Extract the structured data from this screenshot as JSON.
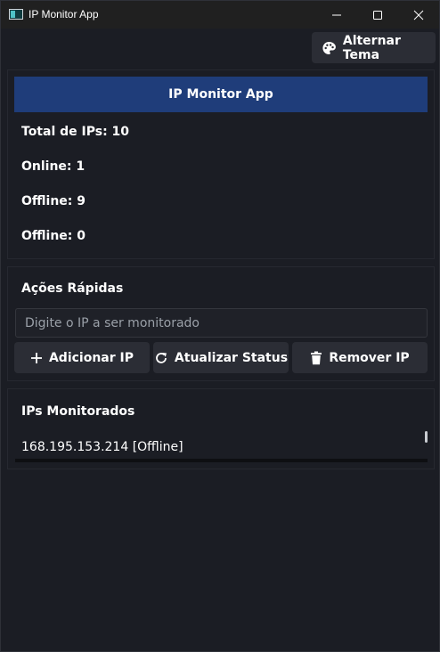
{
  "window": {
    "title": "IP Monitor App",
    "minimize_icon": "minimize-icon",
    "maximize_icon": "maximize-icon",
    "close_icon": "close-icon"
  },
  "toolbar": {
    "theme_button_label": "Alternar Tema",
    "theme_icon": "palette-icon"
  },
  "stats": {
    "header": "IP Monitor App",
    "total": "Total de IPs: 10",
    "online": "Online: 1",
    "offline": "Offline: 9",
    "offline_2": "Offline: 0"
  },
  "actions": {
    "title": "Ações Rápidas",
    "ip_input_placeholder": "Digite o IP a ser monitorado",
    "ip_input_value": "",
    "add_button": "Adicionar IP",
    "refresh_button": "Atualizar Status",
    "remove_button": "Remover IP"
  },
  "monitored": {
    "title": "IPs Monitorados",
    "items": [
      "168.195.153.214 [Offline]"
    ]
  },
  "colors": {
    "background": "#1b1d24",
    "accent": "#1f3d7a",
    "button": "#2b2d35",
    "titlebar": "#202020"
  }
}
